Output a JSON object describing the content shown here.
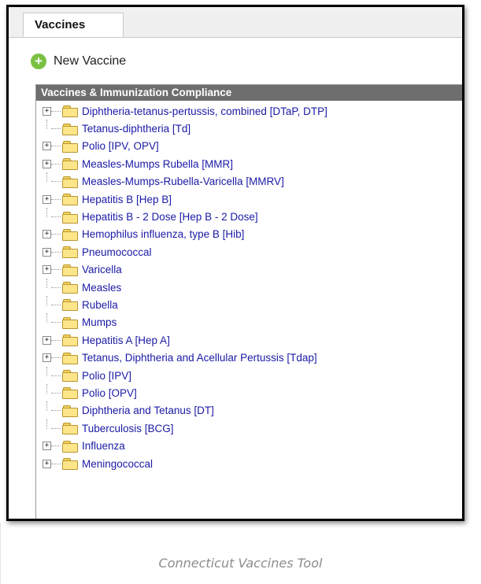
{
  "tabs": {
    "active_label": "Vaccines"
  },
  "toolbar": {
    "new_label": "New Vaccine",
    "new_icon": "plus-icon"
  },
  "tree": {
    "header": "Vaccines & Immunization Compliance",
    "items": [
      {
        "label": "Diphtheria-tetanus-pertussis, combined [DTaP, DTP]",
        "expandable": true
      },
      {
        "label": "Tetanus-diphtheria [Td]",
        "expandable": false
      },
      {
        "label": "Polio [IPV, OPV]",
        "expandable": true
      },
      {
        "label": "Measles-Mumps Rubella [MMR]",
        "expandable": true
      },
      {
        "label": "Measles-Mumps-Rubella-Varicella [MMRV]",
        "expandable": false
      },
      {
        "label": "Hepatitis B [Hep B]",
        "expandable": true
      },
      {
        "label": "Hepatitis B - 2 Dose [Hep B - 2 Dose]",
        "expandable": false
      },
      {
        "label": "Hemophilus influenza, type B [Hib]",
        "expandable": true
      },
      {
        "label": "Pneumococcal",
        "expandable": true
      },
      {
        "label": "Varicella",
        "expandable": true
      },
      {
        "label": "Measles",
        "expandable": false
      },
      {
        "label": "Rubella",
        "expandable": false
      },
      {
        "label": "Mumps",
        "expandable": false
      },
      {
        "label": "Hepatitis A [Hep A]",
        "expandable": true
      },
      {
        "label": "Tetanus, Diphtheria and Acellular Pertussis [Tdap]",
        "expandable": true
      },
      {
        "label": "Polio [IPV]",
        "expandable": false
      },
      {
        "label": "Polio [OPV]",
        "expandable": false
      },
      {
        "label": "Diphtheria and Tetanus [DT]",
        "expandable": false
      },
      {
        "label": "Tuberculosis [BCG]",
        "expandable": false
      },
      {
        "label": "Influenza",
        "expandable": true
      },
      {
        "label": "Meningococcal",
        "expandable": true
      }
    ]
  },
  "caption": "Connecticut Vaccines Tool",
  "colors": {
    "header_bg": "#6e6e6e",
    "link": "#1a1aa6",
    "add_icon": "#7ac142",
    "folder": "#fde58a"
  }
}
